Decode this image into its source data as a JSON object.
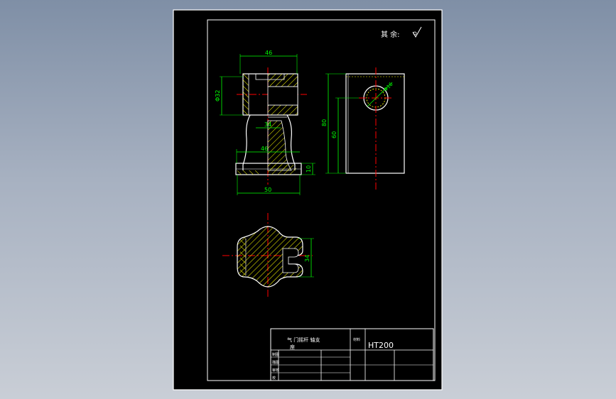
{
  "drawing": {
    "roughness_note": "其 余:",
    "material": "HT200",
    "part_name_line1": "气 门摇杆 轴支",
    "part_name_line2": "座",
    "material_label": "材料"
  },
  "title_block": {
    "row_labels": [
      "制",
      "图",
      "审",
      "核",
      "比",
      "例"
    ],
    "row_labels_left": [
      "制图",
      "描图",
      "审核",
      "校"
    ]
  },
  "dimensions": {
    "front_top_width": "46",
    "front_left_height": "Φ32",
    "front_neck": "34",
    "front_mid": "46",
    "front_base_width": "50",
    "front_base_height": "10",
    "side_height_total": "80",
    "side_height_inner": "60",
    "side_hole": "Φ16",
    "top_view_height": "34"
  },
  "colors": {
    "paper": "#000000",
    "frame": "#ffffff",
    "dimension": "#00ff00",
    "centerline": "#ff0000",
    "hatch": "#ffff00",
    "outline": "#ffffff"
  }
}
